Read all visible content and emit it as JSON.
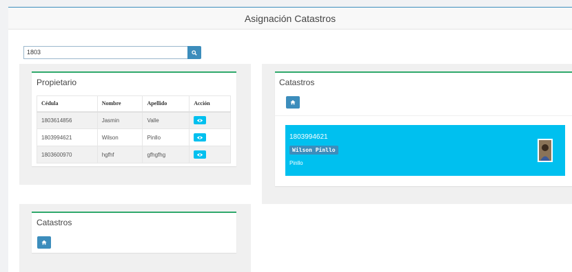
{
  "header": {
    "title": "Asignación Catastros"
  },
  "search": {
    "value": "1803",
    "icon": "search-icon"
  },
  "propietario": {
    "title": "Propietario",
    "columns": [
      "Cédula",
      "Nombre",
      "Apellido",
      "Acción"
    ],
    "rows": [
      {
        "cedula": "1803614856",
        "nombre": "Jasmin",
        "apellido": "Valle",
        "icon": "eye-icon"
      },
      {
        "cedula": "1803994621",
        "nombre": "Wilson",
        "apellido": "Pinllo",
        "icon": "eye-icon"
      },
      {
        "cedula": "1803600970",
        "nombre": "hgfhf",
        "apellido": "gfhgfhg",
        "icon": "eye-icon"
      }
    ]
  },
  "catastros_right": {
    "title": "Catastros",
    "home_icon": "home-icon",
    "card": {
      "cedula": "1803994621",
      "name": "Wilson Pinllo",
      "surname": "Pinllo"
    }
  },
  "catastros_bottom": {
    "title": "Catastros",
    "home_icon": "home-icon"
  },
  "colors": {
    "primary": "#3c8dbc",
    "info": "#00c0ef",
    "success_border": "#2ea86a"
  }
}
